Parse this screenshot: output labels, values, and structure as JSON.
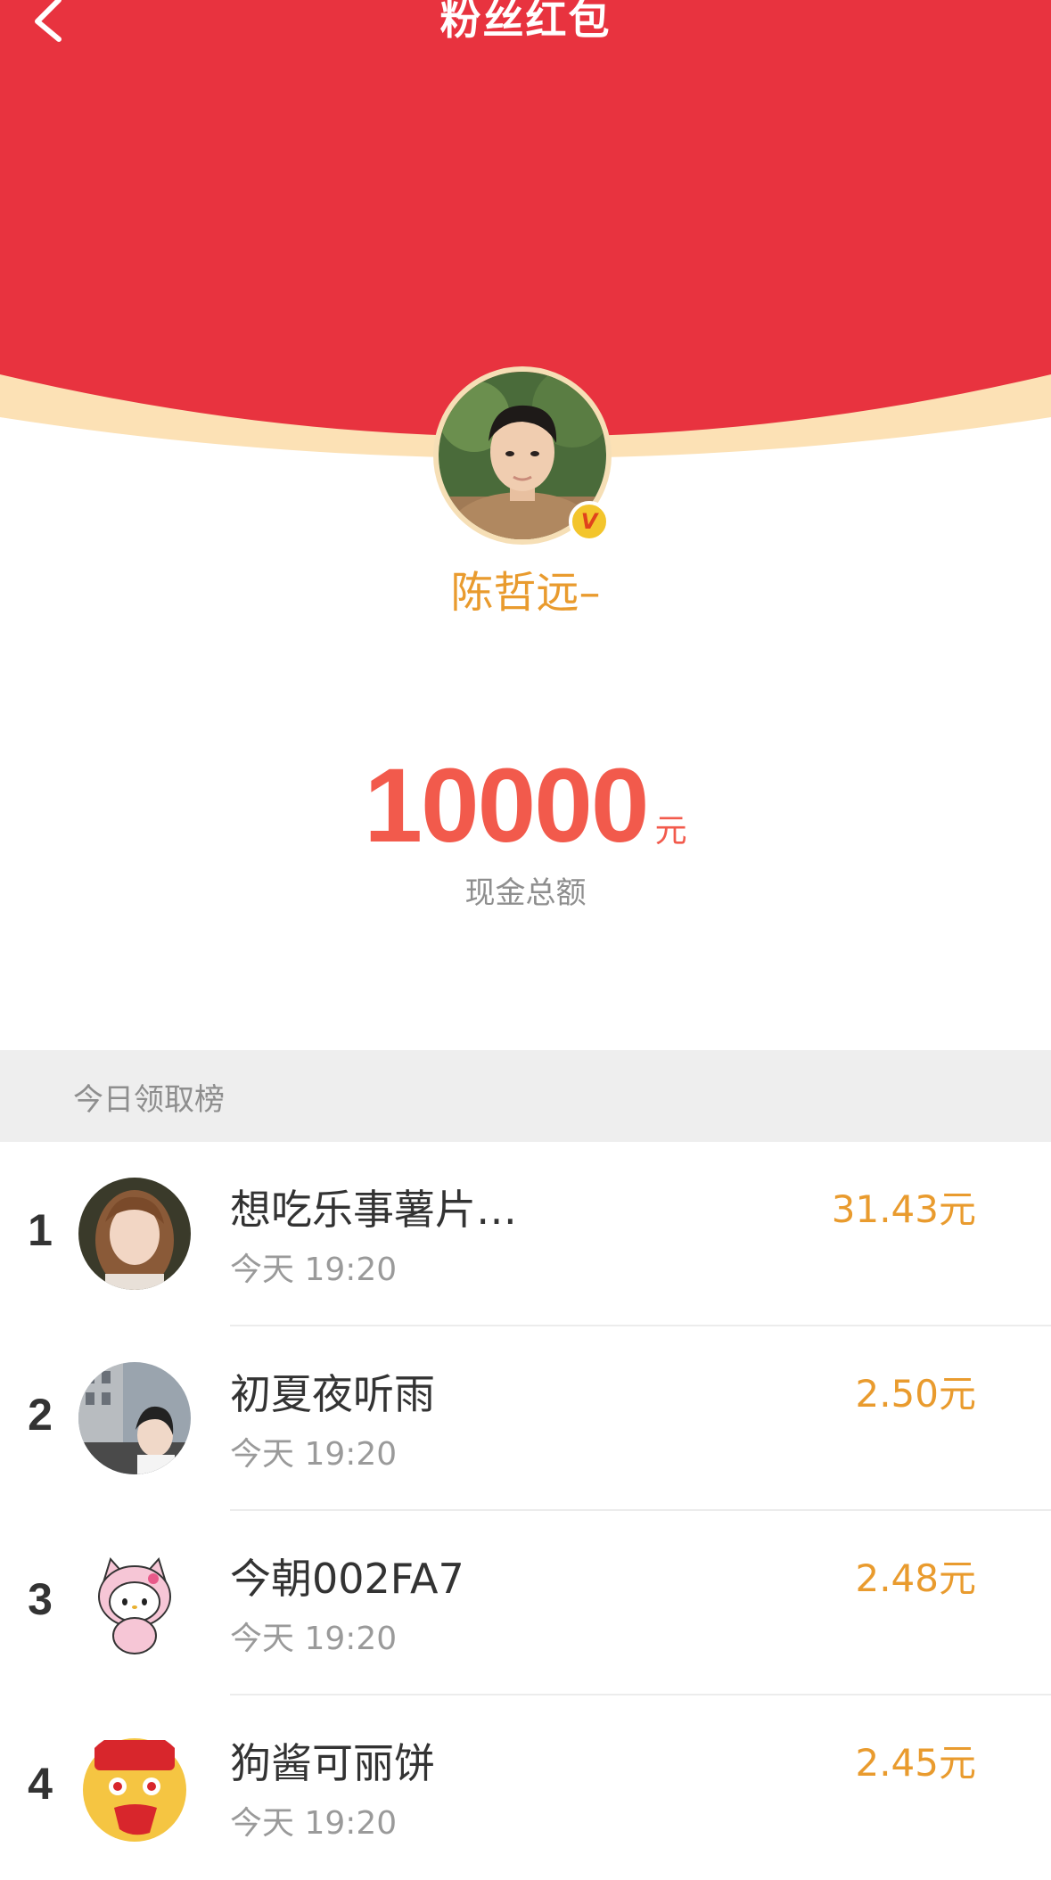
{
  "header": {
    "title": "粉丝红包",
    "back_icon": "chevron-left-icon",
    "bg_color": "#e8333f",
    "rim_color": "#fce1b5"
  },
  "sender": {
    "name": "陈哲远–",
    "verified_badge": "V"
  },
  "total": {
    "amount": "10000",
    "unit": "元",
    "caption": "现金总额"
  },
  "leaderboard": {
    "title": "今日领取榜",
    "rows": [
      {
        "rank": "1",
        "name": "想吃乐事薯片…",
        "time": "今天 19:20",
        "amount": "31.43元"
      },
      {
        "rank": "2",
        "name": "初夏夜听雨",
        "time": "今天 19:20",
        "amount": "2.50元"
      },
      {
        "rank": "3",
        "name": "今朝002FA7",
        "time": "今天 19:20",
        "amount": "2.48元"
      },
      {
        "rank": "4",
        "name": "狗酱可丽饼",
        "time": "今天 19:20",
        "amount": "2.45元"
      }
    ]
  },
  "colors": {
    "accent_gold": "#e99b2e",
    "amount_red": "#f25a4c"
  }
}
